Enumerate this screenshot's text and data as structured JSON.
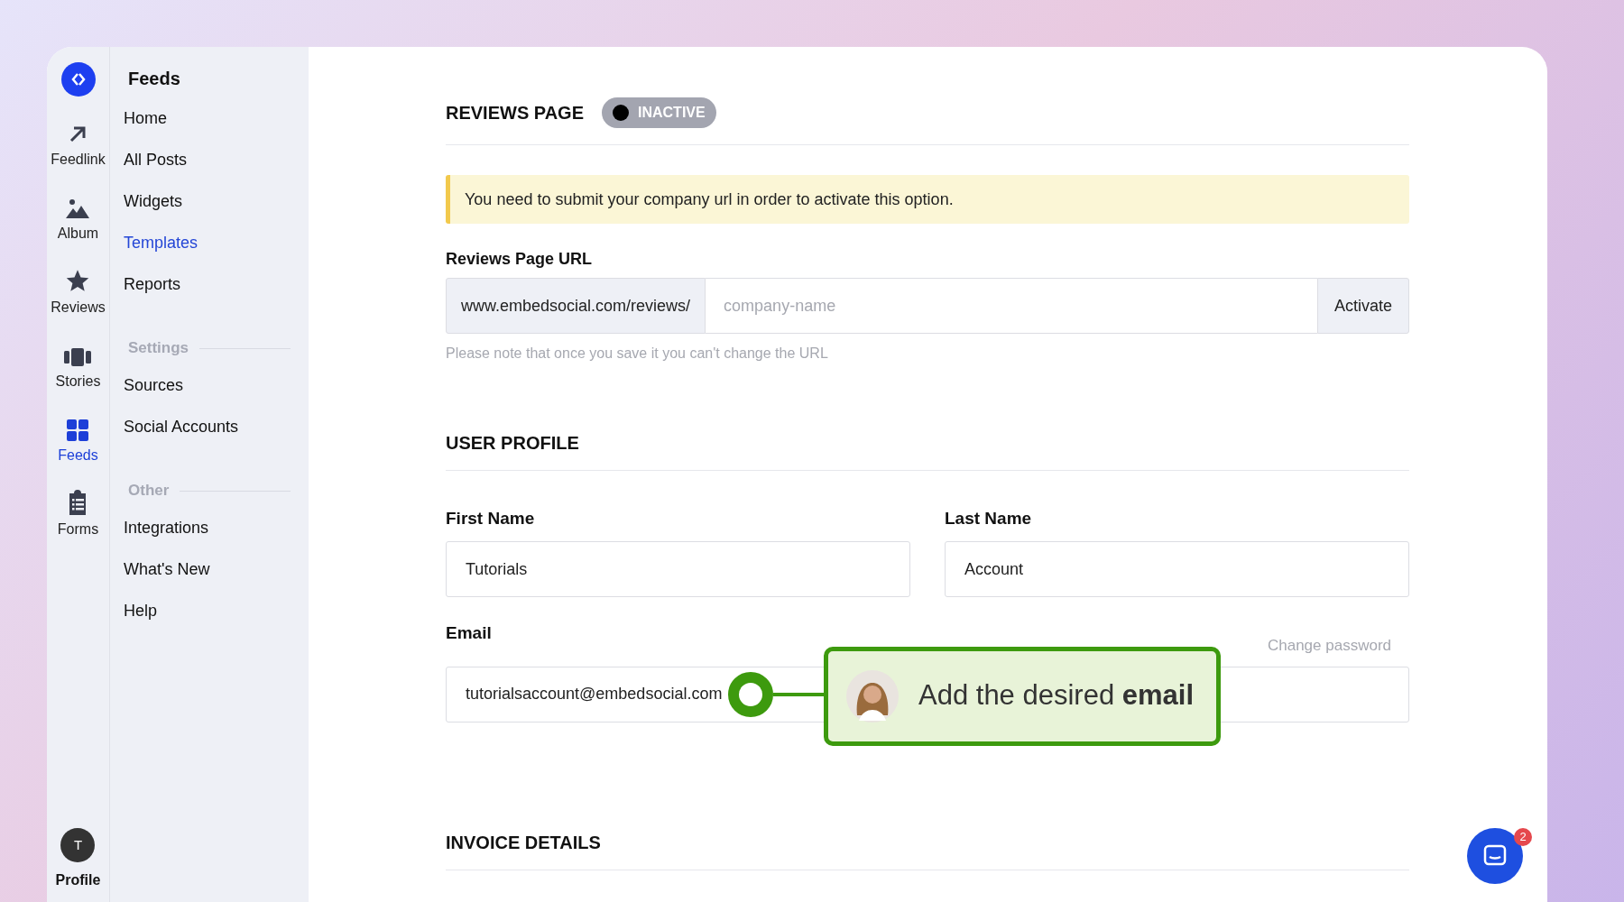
{
  "rail": {
    "items": [
      {
        "kind": "feedlink",
        "label": "Feedlink",
        "selected": false
      },
      {
        "kind": "album",
        "label": "Album",
        "selected": false
      },
      {
        "kind": "reviews",
        "label": "Reviews",
        "selected": false
      },
      {
        "kind": "stories",
        "label": "Stories",
        "selected": false
      },
      {
        "kind": "feeds",
        "label": "Feeds",
        "selected": true
      },
      {
        "kind": "forms",
        "label": "Forms",
        "selected": false
      }
    ],
    "profile": {
      "initial": "T",
      "label": "Profile"
    }
  },
  "sidebar": {
    "title": "Feeds",
    "sections": [
      {
        "items": [
          {
            "label": "Home",
            "selected": false
          },
          {
            "label": "All Posts",
            "selected": false
          },
          {
            "label": "Widgets",
            "selected": false
          },
          {
            "label": "Templates",
            "selected": true
          },
          {
            "label": "Reports",
            "selected": false
          }
        ]
      },
      {
        "heading": "Settings",
        "items": [
          {
            "label": "Sources",
            "selected": false
          },
          {
            "label": "Social Accounts",
            "selected": false
          }
        ]
      },
      {
        "heading": "Other",
        "items": [
          {
            "label": "Integrations",
            "selected": false
          },
          {
            "label": "What's New",
            "selected": false
          },
          {
            "label": "Help",
            "selected": false
          }
        ]
      }
    ]
  },
  "reviews_page": {
    "title": "REVIEWS PAGE",
    "status": {
      "label": "INACTIVE",
      "on": false
    },
    "alert": "You need to submit your company url in order to activate this option.",
    "url": {
      "label": "Reviews Page URL",
      "prefix": "www.embedsocial.com/reviews/",
      "placeholder": "company-name",
      "button": "Activate",
      "note": "Please note that once you save it you can't change the URL"
    }
  },
  "user_profile": {
    "title": "USER PROFILE",
    "first_name": {
      "label": "First Name",
      "value": "Tutorials"
    },
    "last_name": {
      "label": "Last Name",
      "value": "Account"
    },
    "email": {
      "label": "Email",
      "value": "tutorialsaccount@embedsocial.com",
      "link": "Change password"
    }
  },
  "tooltip": {
    "text": "Add the desired **email**"
  },
  "invoice": {
    "title": "INVOICE DETAILS"
  },
  "chat": {
    "badge": "2"
  }
}
